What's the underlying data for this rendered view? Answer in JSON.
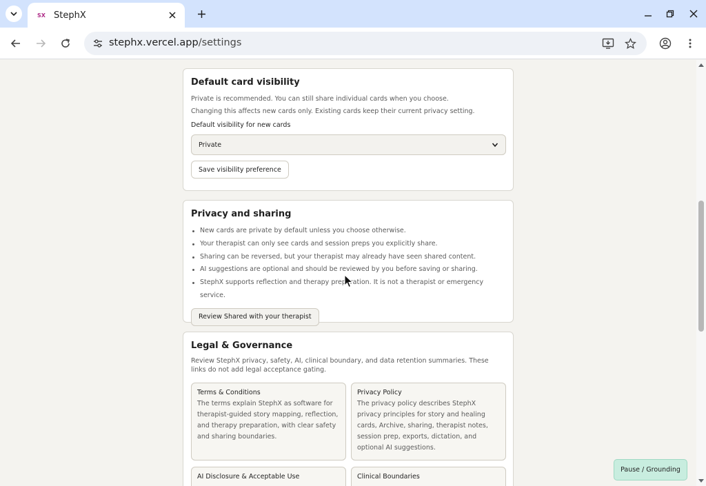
{
  "browser": {
    "tab_title": "StephX",
    "favicon_text": "SX",
    "url_host": "stephx.vercel.app",
    "url_path": "/settings"
  },
  "visibility_card": {
    "title": "Default card visibility",
    "line1": "Private is recommended. You can still share individual cards when you choose.",
    "line2": "Changing this affects new cards only. Existing cards keep their current privacy setting.",
    "field_label": "Default visibility for new cards",
    "selected_value": "Private",
    "save_label": "Save visibility preference"
  },
  "privacy_card": {
    "title": "Privacy and sharing",
    "items": [
      "New cards are private by default unless you choose otherwise.",
      "Your therapist can only see cards and session preps you explicitly share.",
      "Sharing can be reversed, but your therapist may already have seen shared content.",
      "AI suggestions are optional and should be reviewed by you before saving or sharing.",
      "StephX supports reflection and therapy preparation. It is not a therapist or emergency service."
    ],
    "review_label": "Review Shared with your therapist"
  },
  "legal_card": {
    "title": "Legal & Governance",
    "intro": "Review StephX privacy, safety, AI, clinical boundary, and data retention summaries. These links do not add legal acceptance gating.",
    "docs": [
      {
        "title": "Terms & Conditions",
        "description": "The terms explain StephX as software for therapist-guided story mapping, reflection, and therapy preparation, with clear safety and sharing boundaries."
      },
      {
        "title": "Privacy Policy",
        "description": "The privacy policy describes StephX privacy principles for story and healing cards, Archive, sharing, therapist notes, session prep, exports, dictation, and optional AI suggestions."
      },
      {
        "title": "AI Disclosure & Acceptable Use",
        "description": ""
      },
      {
        "title": "Clinical Boundaries",
        "description": ""
      }
    ]
  },
  "pause_button_label": "Pause / Grounding",
  "colors": {
    "tab_strip": "#d3e3fd",
    "page_bg": "#f4f3ef",
    "pause_bg": "#c8eddf"
  }
}
